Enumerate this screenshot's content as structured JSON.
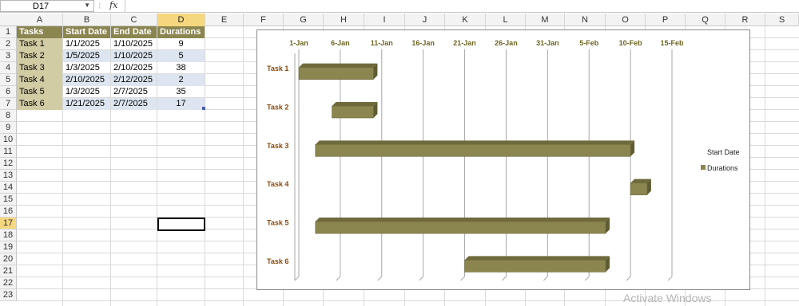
{
  "formula_bar": {
    "name_box": "D17",
    "fx_label": "fx",
    "formula": ""
  },
  "columns": [
    "A",
    "B",
    "C",
    "D",
    "E",
    "F",
    "G",
    "H",
    "I",
    "J",
    "K",
    "L",
    "M",
    "N",
    "O",
    "P",
    "Q",
    "R",
    "S"
  ],
  "selected_column": "D",
  "rows": [
    "1",
    "2",
    "3",
    "4",
    "5",
    "6",
    "7",
    "8",
    "9",
    "10",
    "11",
    "12",
    "13",
    "14",
    "15",
    "16",
    "17",
    "18",
    "19",
    "20",
    "21",
    "22",
    "23"
  ],
  "selected_row": "17",
  "table": {
    "headers": [
      "Tasks",
      "Start Date",
      "End Date",
      "Durations"
    ],
    "rows": [
      [
        "Task 1",
        "1/1/2025",
        "1/10/2025",
        "9"
      ],
      [
        "Task 2",
        "1/5/2025",
        "1/10/2025",
        "5"
      ],
      [
        "Task 3",
        "1/3/2025",
        "2/10/2025",
        "38"
      ],
      [
        "Task 4",
        "2/10/2025",
        "2/12/2025",
        "2"
      ],
      [
        "Task 5",
        "1/3/2025",
        "2/7/2025",
        "35"
      ],
      [
        "Task 6",
        "1/21/2025",
        "2/7/2025",
        "17"
      ]
    ]
  },
  "chart_data": {
    "type": "bar",
    "orientation": "horizontal",
    "stacked": true,
    "categories": [
      "Task 1",
      "Task 2",
      "Task 3",
      "Task 4",
      "Task 5",
      "Task 6"
    ],
    "series": [
      {
        "name": "Start Date",
        "values": [
          "2025-01-01",
          "2025-01-05",
          "2025-01-03",
          "2025-02-10",
          "2025-01-03",
          "2025-01-21"
        ],
        "visible": false
      },
      {
        "name": "Durations",
        "values": [
          9,
          5,
          38,
          2,
          35,
          17
        ],
        "color": "#8b8550"
      }
    ],
    "x_ticks": [
      "1-Jan",
      "6-Jan",
      "11-Jan",
      "16-Jan",
      "21-Jan",
      "26-Jan",
      "31-Jan",
      "5-Feb",
      "10-Feb",
      "15-Feb"
    ],
    "xlim": [
      "2025-01-01",
      "2025-02-15"
    ],
    "x_axis_position": "top",
    "legend": "right",
    "grid": true,
    "bar_color": "#8b8550",
    "label_color": "#8a4a0a",
    "tick_color": "#6b6420"
  },
  "watermark": "Activate Windows"
}
